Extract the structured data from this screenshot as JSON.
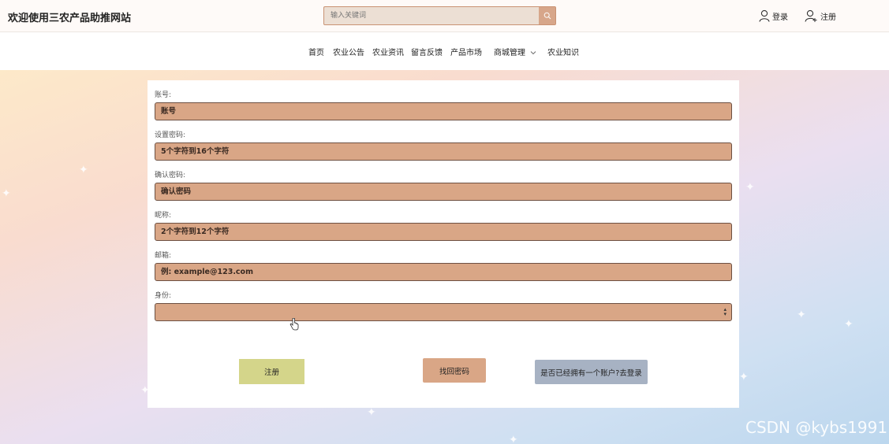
{
  "site": {
    "title": "欢迎使用三农产品助推网站"
  },
  "search": {
    "placeholder": "输入关键词"
  },
  "auth": {
    "login_label": "登录",
    "register_label": "注册"
  },
  "nav": {
    "items": [
      {
        "label": "首页"
      },
      {
        "label": "农业公告"
      },
      {
        "label": "农业资讯"
      },
      {
        "label": "留言反馈"
      },
      {
        "label": "产品市场"
      },
      {
        "label": "商城管理"
      },
      {
        "label": "农业知识"
      }
    ]
  },
  "form": {
    "account": {
      "label": "账号:",
      "placeholder": "账号"
    },
    "password": {
      "label": "设置密码:",
      "placeholder": "5个字符到16个字符"
    },
    "confirm": {
      "label": "确认密码:",
      "placeholder": "确认密码"
    },
    "nickname": {
      "label": "昵称:",
      "placeholder": "2个字符到12个字符"
    },
    "email": {
      "label": "邮箱:",
      "placeholder": "例: example@123.com"
    },
    "role": {
      "label": "身份:",
      "value": ""
    }
  },
  "buttons": {
    "register": "注册",
    "find_password": "找回密码",
    "goto_login": "是否已经拥有一个账户?去登录"
  },
  "watermark": "CSDN @kybs1991",
  "colors": {
    "field_bg": "#d9a686",
    "register_btn": "#d4d58a",
    "find_btn": "#d9a686",
    "login_btn": "#a7b2c3"
  }
}
